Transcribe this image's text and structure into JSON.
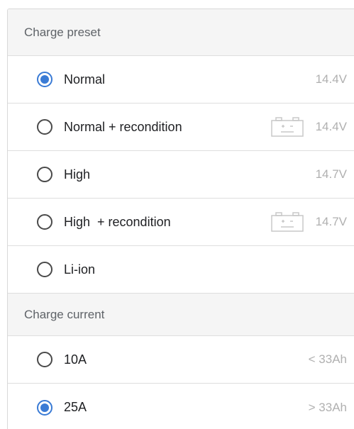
{
  "charge_preset": {
    "header": "Charge preset",
    "options": [
      {
        "label": "Normal",
        "value": "14.4V",
        "checked": true,
        "icon": null
      },
      {
        "label": "Normal + recondition",
        "value": "14.4V",
        "checked": false,
        "icon": "battery-icon"
      },
      {
        "label": "High",
        "value": "14.7V",
        "checked": false,
        "icon": null
      },
      {
        "label": "High  + recondition",
        "value": "14.7V",
        "checked": false,
        "icon": "battery-icon"
      },
      {
        "label": "Li-ion",
        "value": "",
        "checked": false,
        "icon": null
      }
    ]
  },
  "charge_current": {
    "header": "Charge current",
    "options": [
      {
        "label": "10A",
        "value": "< 33Ah",
        "checked": false
      },
      {
        "label": "25A",
        "value": "> 33Ah",
        "checked": true
      }
    ]
  },
  "colors": {
    "accent": "#3a7bd5",
    "muted_text": "#b0b0b0",
    "header_bg": "#f5f5f5"
  }
}
